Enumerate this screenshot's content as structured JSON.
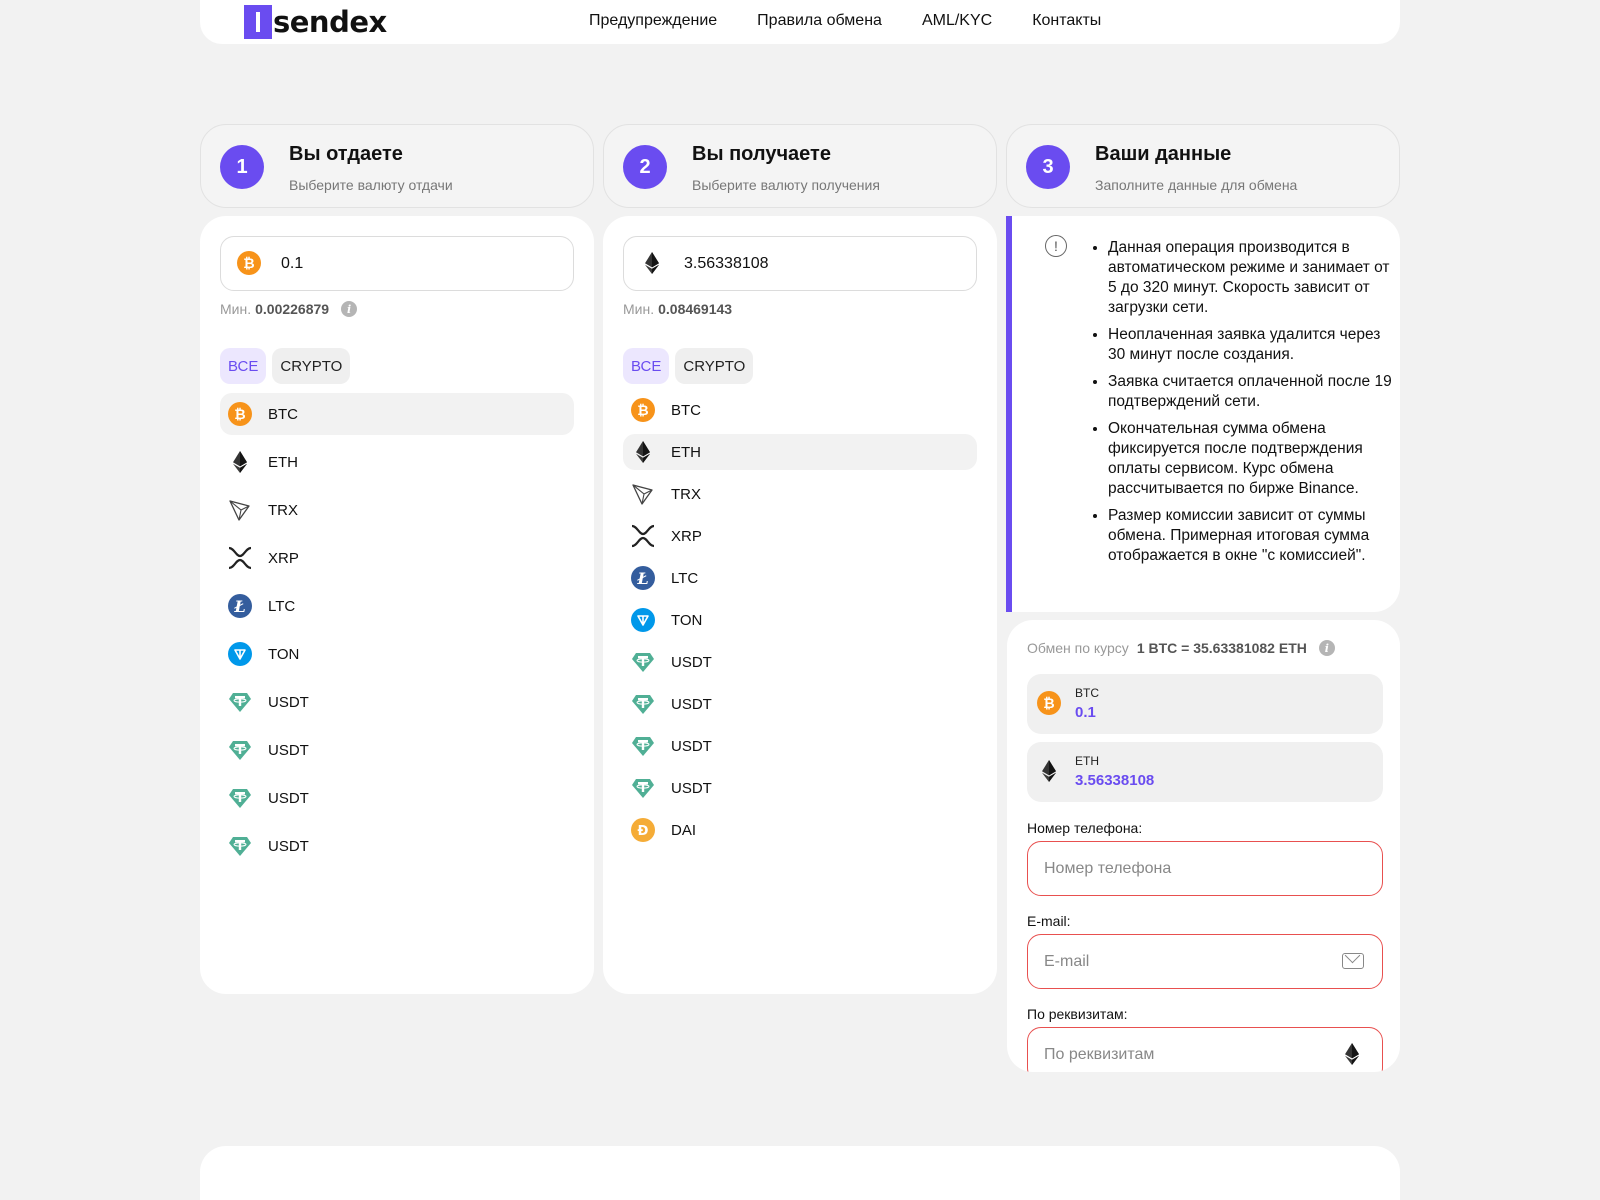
{
  "brand": {
    "name": "sendex",
    "accent": "#6a4cf0"
  },
  "nav": [
    "Предупреждение",
    "Правила обмена",
    "AML/KYC",
    "Контакты"
  ],
  "steps": [
    {
      "num": "1",
      "title": "Вы отдаете",
      "subtitle": "Выберите валюту отдачи"
    },
    {
      "num": "2",
      "title": "Вы получаете",
      "subtitle": "Выберите валюту получения"
    },
    {
      "num": "3",
      "title": "Ваши данные",
      "subtitle": "Заполните данные для обмена"
    }
  ],
  "give": {
    "amount": "0.1",
    "coin_icon": "btc-icon",
    "min_label": "Мин.",
    "min_value": "0.00226879",
    "filters": {
      "all": "ВСЕ",
      "crypto": "CRYPTO"
    },
    "currencies": [
      {
        "label": "BTC",
        "icon": "btc"
      },
      {
        "label": "ETH",
        "icon": "eth"
      },
      {
        "label": "TRX",
        "icon": "trx"
      },
      {
        "label": "XRP",
        "icon": "xrp"
      },
      {
        "label": "LTC",
        "icon": "ltc"
      },
      {
        "label": "TON",
        "icon": "ton"
      },
      {
        "label": "USDT",
        "icon": "usdt"
      },
      {
        "label": "USDT",
        "icon": "usdt"
      },
      {
        "label": "USDT",
        "icon": "usdt"
      },
      {
        "label": "USDT",
        "icon": "usdt"
      }
    ],
    "selected_index": 0
  },
  "receive": {
    "amount": "3.56338108",
    "coin_icon": "eth-icon",
    "min_label": "Мин.",
    "min_value": "0.08469143",
    "filters": {
      "all": "ВСЕ",
      "crypto": "CRYPTO"
    },
    "currencies": [
      {
        "label": "BTC",
        "icon": "btc"
      },
      {
        "label": "ETH",
        "icon": "eth"
      },
      {
        "label": "TRX",
        "icon": "trx"
      },
      {
        "label": "XRP",
        "icon": "xrp"
      },
      {
        "label": "LTC",
        "icon": "ltc"
      },
      {
        "label": "TON",
        "icon": "ton"
      },
      {
        "label": "USDT",
        "icon": "usdt"
      },
      {
        "label": "USDT",
        "icon": "usdt"
      },
      {
        "label": "USDT",
        "icon": "usdt"
      },
      {
        "label": "USDT",
        "icon": "usdt"
      },
      {
        "label": "DAI",
        "icon": "dai"
      }
    ],
    "selected_index": 1
  },
  "notes": [
    "Данная операция производится в автоматическом режиме и занимает от 5 до 320 минут. Скорость зависит от загрузки сети.",
    "Неоплаченная заявка удалится через 30 минут после создания.",
    "Заявка считается оплаченной после 19 подтверждений сети.",
    "Окончательная сумма обмена фиксируется после подтверждения оплаты сервисом. Курс обмена рассчитывается по бирже Binance.",
    "Размер комиссии зависит от суммы обмена. Примерная итоговая сумма отображается в окне \"с комиссией\"."
  ],
  "exchange": {
    "rate_label": "Обмен по курсу",
    "rate_value": "1 BTC = 35.63381082 ETH",
    "from": {
      "ticker": "BTC",
      "amount": "0.1"
    },
    "to": {
      "ticker": "ETH",
      "amount": "3.56338108"
    },
    "phone": {
      "label": "Номер телефона:",
      "placeholder": "Номер телефона"
    },
    "email": {
      "label": "E-mail:",
      "placeholder": "E-mail"
    },
    "requisites": {
      "label": "По реквизитам:",
      "placeholder": "По реквизитам"
    }
  },
  "colors": {
    "btc": "#f7931a",
    "ton": "#0098ea",
    "usdt": "#50af95",
    "ltc": "#345d9d",
    "dai": "#f5ac37",
    "error": "#e8504f"
  }
}
